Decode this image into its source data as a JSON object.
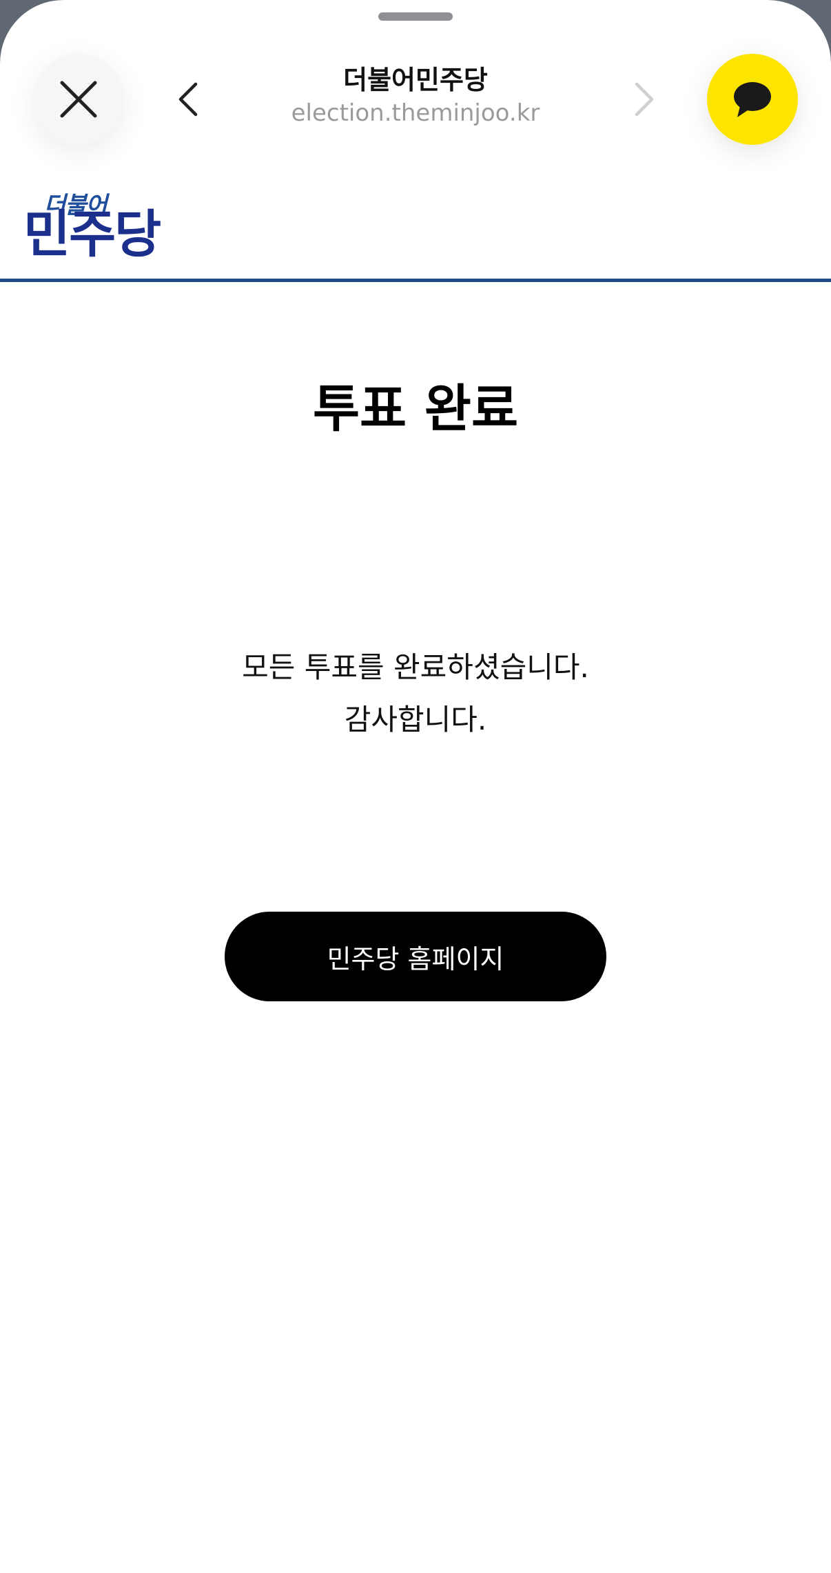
{
  "header": {
    "site_title": "더불어민주당",
    "site_url": "election.theminjoo.kr",
    "close_icon": "close-icon",
    "back_icon": "chevron-left-icon",
    "forward_icon": "chevron-right-icon",
    "chat_icon": "speech-bubble-icon"
  },
  "logo": {
    "small_text": "더불어",
    "big_text": "민주당",
    "color": "#1b2f8c"
  },
  "main": {
    "title": "투표 완료",
    "message_line1": "모든 투표를 완료하셨습니다.",
    "message_line2": "감사합니다.",
    "home_button_label": "민주당 홈페이지"
  },
  "colors": {
    "kakao_yellow": "#FEE500",
    "divider_blue": "#1f4a8a",
    "button_black": "#000000"
  }
}
